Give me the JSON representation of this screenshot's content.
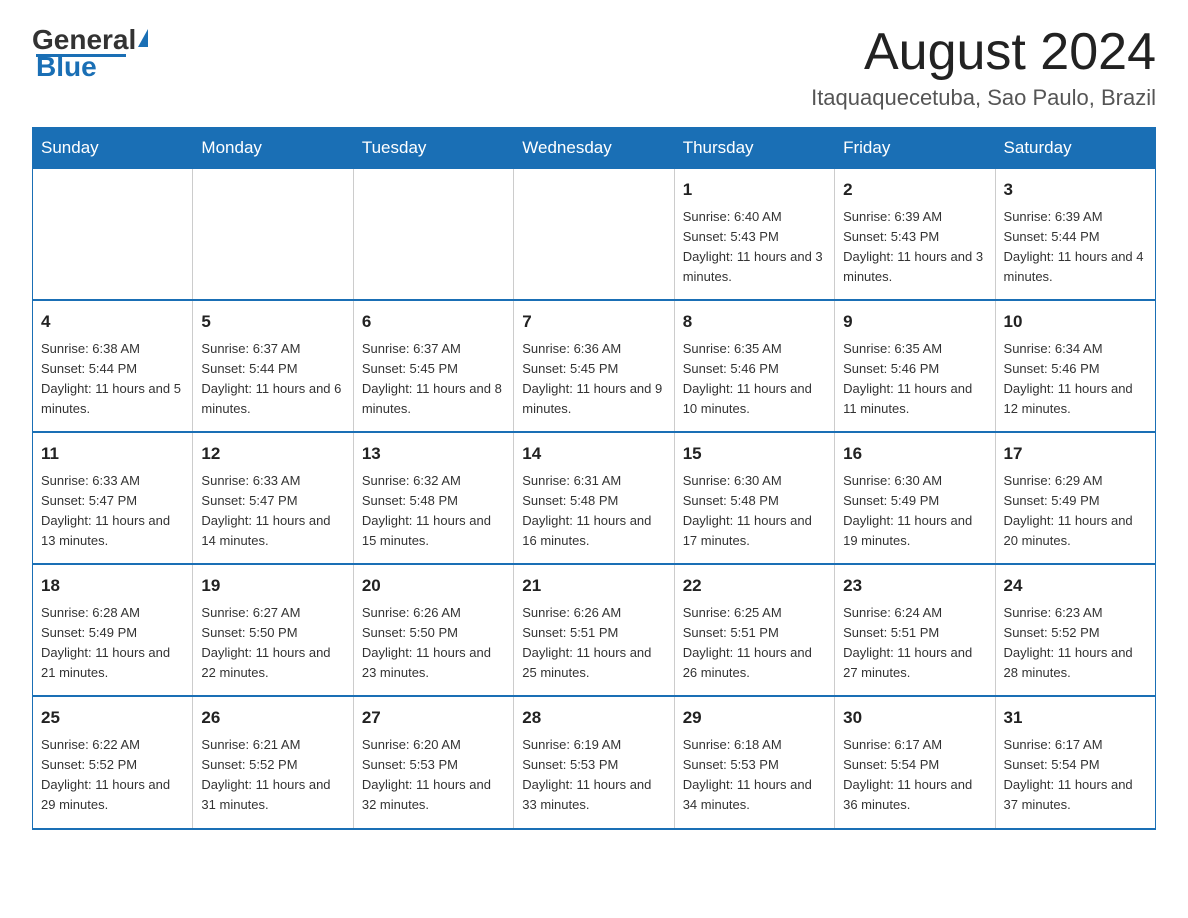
{
  "logo": {
    "general": "General",
    "blue": "Blue"
  },
  "title": "August 2024",
  "location": "Itaquaquecetuba, Sao Paulo, Brazil",
  "days_of_week": [
    "Sunday",
    "Monday",
    "Tuesday",
    "Wednesday",
    "Thursday",
    "Friday",
    "Saturday"
  ],
  "weeks": [
    [
      {
        "day": "",
        "info": ""
      },
      {
        "day": "",
        "info": ""
      },
      {
        "day": "",
        "info": ""
      },
      {
        "day": "",
        "info": ""
      },
      {
        "day": "1",
        "info": "Sunrise: 6:40 AM\nSunset: 5:43 PM\nDaylight: 11 hours\nand 3 minutes."
      },
      {
        "day": "2",
        "info": "Sunrise: 6:39 AM\nSunset: 5:43 PM\nDaylight: 11 hours\nand 3 minutes."
      },
      {
        "day": "3",
        "info": "Sunrise: 6:39 AM\nSunset: 5:44 PM\nDaylight: 11 hours\nand 4 minutes."
      }
    ],
    [
      {
        "day": "4",
        "info": "Sunrise: 6:38 AM\nSunset: 5:44 PM\nDaylight: 11 hours\nand 5 minutes."
      },
      {
        "day": "5",
        "info": "Sunrise: 6:37 AM\nSunset: 5:44 PM\nDaylight: 11 hours\nand 6 minutes."
      },
      {
        "day": "6",
        "info": "Sunrise: 6:37 AM\nSunset: 5:45 PM\nDaylight: 11 hours\nand 8 minutes."
      },
      {
        "day": "7",
        "info": "Sunrise: 6:36 AM\nSunset: 5:45 PM\nDaylight: 11 hours\nand 9 minutes."
      },
      {
        "day": "8",
        "info": "Sunrise: 6:35 AM\nSunset: 5:46 PM\nDaylight: 11 hours\nand 10 minutes."
      },
      {
        "day": "9",
        "info": "Sunrise: 6:35 AM\nSunset: 5:46 PM\nDaylight: 11 hours\nand 11 minutes."
      },
      {
        "day": "10",
        "info": "Sunrise: 6:34 AM\nSunset: 5:46 PM\nDaylight: 11 hours\nand 12 minutes."
      }
    ],
    [
      {
        "day": "11",
        "info": "Sunrise: 6:33 AM\nSunset: 5:47 PM\nDaylight: 11 hours\nand 13 minutes."
      },
      {
        "day": "12",
        "info": "Sunrise: 6:33 AM\nSunset: 5:47 PM\nDaylight: 11 hours\nand 14 minutes."
      },
      {
        "day": "13",
        "info": "Sunrise: 6:32 AM\nSunset: 5:48 PM\nDaylight: 11 hours\nand 15 minutes."
      },
      {
        "day": "14",
        "info": "Sunrise: 6:31 AM\nSunset: 5:48 PM\nDaylight: 11 hours\nand 16 minutes."
      },
      {
        "day": "15",
        "info": "Sunrise: 6:30 AM\nSunset: 5:48 PM\nDaylight: 11 hours\nand 17 minutes."
      },
      {
        "day": "16",
        "info": "Sunrise: 6:30 AM\nSunset: 5:49 PM\nDaylight: 11 hours\nand 19 minutes."
      },
      {
        "day": "17",
        "info": "Sunrise: 6:29 AM\nSunset: 5:49 PM\nDaylight: 11 hours\nand 20 minutes."
      }
    ],
    [
      {
        "day": "18",
        "info": "Sunrise: 6:28 AM\nSunset: 5:49 PM\nDaylight: 11 hours\nand 21 minutes."
      },
      {
        "day": "19",
        "info": "Sunrise: 6:27 AM\nSunset: 5:50 PM\nDaylight: 11 hours\nand 22 minutes."
      },
      {
        "day": "20",
        "info": "Sunrise: 6:26 AM\nSunset: 5:50 PM\nDaylight: 11 hours\nand 23 minutes."
      },
      {
        "day": "21",
        "info": "Sunrise: 6:26 AM\nSunset: 5:51 PM\nDaylight: 11 hours\nand 25 minutes."
      },
      {
        "day": "22",
        "info": "Sunrise: 6:25 AM\nSunset: 5:51 PM\nDaylight: 11 hours\nand 26 minutes."
      },
      {
        "day": "23",
        "info": "Sunrise: 6:24 AM\nSunset: 5:51 PM\nDaylight: 11 hours\nand 27 minutes."
      },
      {
        "day": "24",
        "info": "Sunrise: 6:23 AM\nSunset: 5:52 PM\nDaylight: 11 hours\nand 28 minutes."
      }
    ],
    [
      {
        "day": "25",
        "info": "Sunrise: 6:22 AM\nSunset: 5:52 PM\nDaylight: 11 hours\nand 29 minutes."
      },
      {
        "day": "26",
        "info": "Sunrise: 6:21 AM\nSunset: 5:52 PM\nDaylight: 11 hours\nand 31 minutes."
      },
      {
        "day": "27",
        "info": "Sunrise: 6:20 AM\nSunset: 5:53 PM\nDaylight: 11 hours\nand 32 minutes."
      },
      {
        "day": "28",
        "info": "Sunrise: 6:19 AM\nSunset: 5:53 PM\nDaylight: 11 hours\nand 33 minutes."
      },
      {
        "day": "29",
        "info": "Sunrise: 6:18 AM\nSunset: 5:53 PM\nDaylight: 11 hours\nand 34 minutes."
      },
      {
        "day": "30",
        "info": "Sunrise: 6:17 AM\nSunset: 5:54 PM\nDaylight: 11 hours\nand 36 minutes."
      },
      {
        "day": "31",
        "info": "Sunrise: 6:17 AM\nSunset: 5:54 PM\nDaylight: 11 hours\nand 37 minutes."
      }
    ]
  ]
}
